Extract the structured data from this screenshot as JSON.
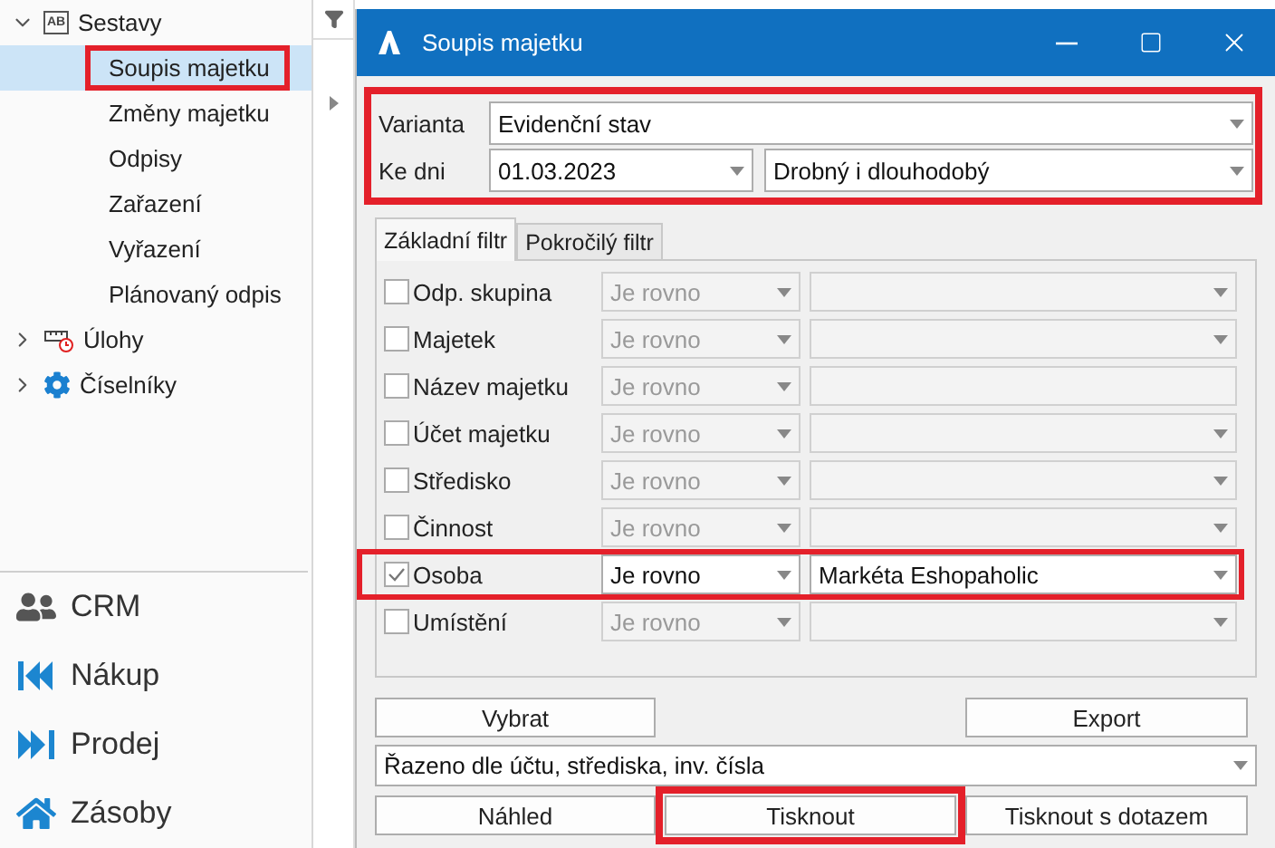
{
  "sidebar": {
    "tree": [
      {
        "label": "Sestavy",
        "badge": "AB",
        "kind": "report",
        "expanded": true,
        "selected": false,
        "children": [
          {
            "label": "Soupis majetku",
            "selected": true,
            "highlighted": true
          },
          {
            "label": "Změny majetku",
            "selected": false,
            "highlighted": false
          },
          {
            "label": "Odpisy",
            "selected": false,
            "highlighted": false
          },
          {
            "label": "Zařazení",
            "selected": false,
            "highlighted": false
          },
          {
            "label": "Vyřazení",
            "selected": false,
            "highlighted": false
          },
          {
            "label": "Plánovaný odpis",
            "selected": false,
            "highlighted": false
          }
        ]
      },
      {
        "label": "Úlohy",
        "kind": "tasks",
        "expanded": false,
        "selected": false
      },
      {
        "label": "Číselníky",
        "kind": "gear",
        "expanded": false,
        "selected": false
      }
    ],
    "modules": [
      {
        "label": "CRM",
        "kind": "users"
      },
      {
        "label": "Nákup",
        "kind": "back"
      },
      {
        "label": "Prodej",
        "kind": "forward"
      },
      {
        "label": "Zásoby",
        "kind": "home"
      }
    ]
  },
  "dialog": {
    "title": "Soupis majetku",
    "header": {
      "highlighted": true,
      "variant_label": "Varianta",
      "variant": "Evidenční stav",
      "date_label": "Ke dni",
      "date": "01.03.2023",
      "type": "Drobný i dlouhodobý"
    },
    "tabs": [
      {
        "label": "Základní filtr",
        "selected": true
      },
      {
        "label": "Pokročilý filtr",
        "selected": false
      }
    ],
    "filters": [
      {
        "label": "Odp. skupina",
        "checked": false,
        "operator": "Je rovno",
        "kind": "combo",
        "highlighted": false
      },
      {
        "label": "Majetek",
        "checked": false,
        "operator": "Je rovno",
        "kind": "combo",
        "highlighted": false
      },
      {
        "label": "Název majetku",
        "checked": false,
        "operator": "Je rovno",
        "kind": "text",
        "highlighted": false
      },
      {
        "label": "Účet majetku",
        "checked": false,
        "operator": "Je rovno",
        "kind": "combo",
        "highlighted": false
      },
      {
        "label": "Středisko",
        "checked": false,
        "operator": "Je rovno",
        "kind": "combo",
        "highlighted": false
      },
      {
        "label": "Činnost",
        "checked": false,
        "operator": "Je rovno",
        "kind": "combo",
        "highlighted": false
      },
      {
        "label": "Osoba",
        "checked": true,
        "operator": "Je rovno",
        "kind": "combo",
        "value": "Markéta Eshopaholic",
        "highlighted": true
      },
      {
        "label": "Umístění",
        "checked": false,
        "operator": "Je rovno",
        "kind": "combo",
        "highlighted": false
      }
    ],
    "actions_top": [
      {
        "label": "Vybrat"
      },
      {
        "label": "Export"
      }
    ],
    "sort": "Řazeno dle účtu, střediska, inv. čísla",
    "actions_bottom": [
      {
        "label": "Náhled",
        "highlighted": false
      },
      {
        "label": "Tisknout",
        "highlighted": true
      },
      {
        "label": "Tisknout s dotazem",
        "highlighted": false
      }
    ]
  }
}
